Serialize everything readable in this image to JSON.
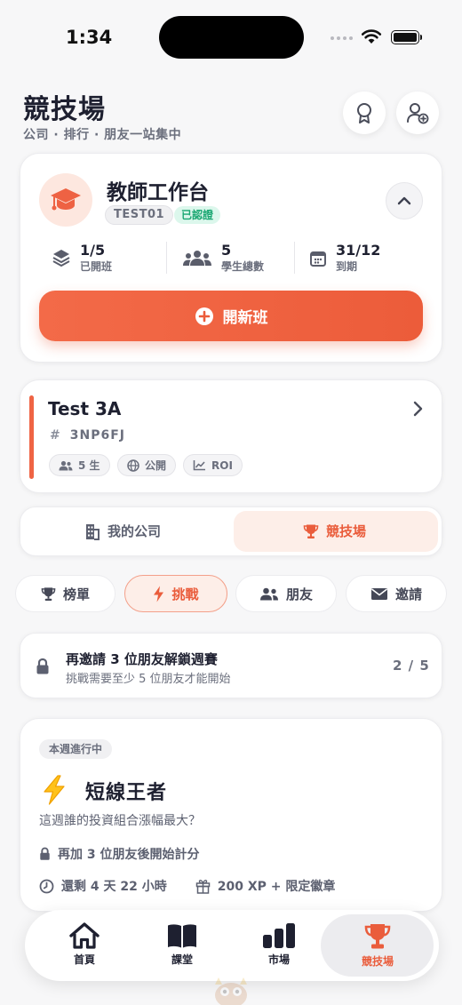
{
  "status_bar": {
    "time": "1:34"
  },
  "header": {
    "title": "競技場",
    "subtitle": "公司 · 排行 · 朋友一站集中"
  },
  "teacher_card": {
    "title": "教師工作台",
    "code": "TEST01",
    "verified": "已認證",
    "stats": [
      {
        "value": "1/5",
        "label": "已開班"
      },
      {
        "value": "5",
        "label": "學生總數"
      },
      {
        "value": "31/12",
        "label": "到期"
      }
    ],
    "new_class_label": "開新班"
  },
  "class_card": {
    "name": "Test 3A",
    "hash": "#",
    "code": "3NP6FJ",
    "chips": [
      "5 生",
      "公開",
      "ROI"
    ]
  },
  "segment": {
    "tabs": [
      "我的公司",
      "競技場"
    ],
    "active": "競技場"
  },
  "filters": {
    "tabs": [
      "榜單",
      "挑戰",
      "朋友",
      "邀請"
    ],
    "active": "挑戰"
  },
  "invite_banner": {
    "title": "再邀請 3 位朋友解鎖週賽",
    "subtitle": "挑戰需要至少 5 位朋友才能開始",
    "progress": "2 / 5"
  },
  "challenge": {
    "badge": "本週進行中",
    "emoji": "⚡",
    "title": "短線王者",
    "description": "這週誰的投資組合漲幅最大？",
    "lock_text": "再加 3 位朋友後開始計分",
    "time_left": "還剩 4 天 22 小時",
    "reward": "200 XP + 限定徽章"
  },
  "bottom_nav": {
    "items": [
      "首頁",
      "課堂",
      "市場",
      "競技場"
    ],
    "active": "競技場"
  },
  "colors": {
    "accent": "#ea5d3c",
    "accent_soft": "#fdeee8",
    "verified_green": "#1aa772",
    "text": "#1e2030",
    "muted": "#6b6f7d"
  }
}
